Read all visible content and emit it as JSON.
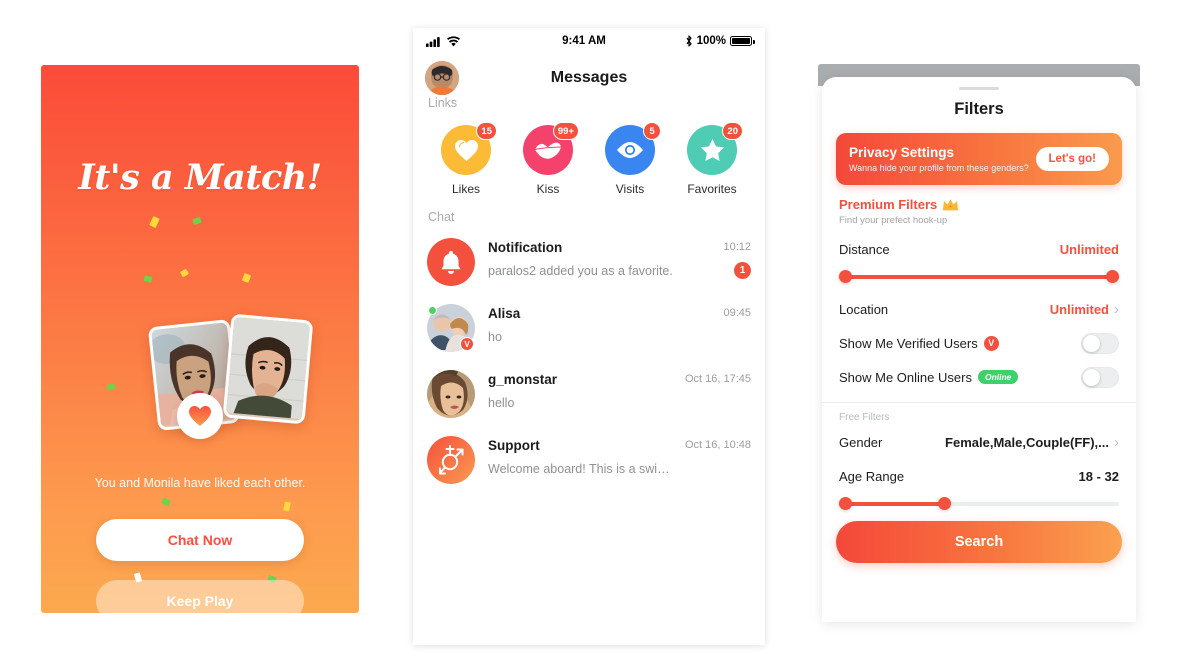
{
  "match_screen": {
    "title": "It's a Match!",
    "caption": "You and Monila have liked each other.",
    "primary_button": "Chat Now",
    "secondary_button": "Keep Play",
    "heart_icon": "heart-icon",
    "gradient_from": "#FB4B39",
    "gradient_to": "#FCA94F",
    "confetti_colors": [
      "#6CD34A",
      "#FFD83B",
      "#FFFFFF"
    ]
  },
  "messages_screen": {
    "status_bar": {
      "signal_icon": "cellular-signal-icon",
      "wifi_icon": "wifi-icon",
      "time": "9:41 AM",
      "bluetooth_icon": "bluetooth-icon",
      "battery_percent": "100%",
      "battery_icon": "battery-full-icon"
    },
    "header": {
      "title": "Messages",
      "avatar": "user-avatar",
      "links_label": "Links"
    },
    "quick_icons": [
      {
        "label": "Likes",
        "badge": "15",
        "color": "#FBBB36",
        "icon": "heart-icon"
      },
      {
        "label": "Kiss",
        "badge": "99+",
        "color": "#F5426C",
        "icon": "lips-icon"
      },
      {
        "label": "Visits",
        "badge": "5",
        "color": "#3A86F0",
        "icon": "eye-icon"
      },
      {
        "label": "Favorites",
        "badge": "20",
        "color": "#4ECDB4",
        "icon": "star-icon"
      }
    ],
    "chat_label": "Chat",
    "chats": [
      {
        "name": "Notification",
        "preview": "paralos2 added you as a favorite.",
        "time": "10:12",
        "unread": "1",
        "avatar_type": "bell-icon",
        "avatar_color": "#F4503E",
        "online": false,
        "verified": false
      },
      {
        "name": "Alisa",
        "preview": "ho",
        "time": "09:45",
        "unread": "",
        "avatar_type": "photo",
        "avatar_color": "#9ba7b4",
        "online": true,
        "verified": true
      },
      {
        "name": "g_monstar",
        "preview": "hello",
        "time": "Oct 16, 17:45",
        "unread": "",
        "avatar_type": "photo",
        "avatar_color": "#b8936a",
        "online": false,
        "verified": false
      },
      {
        "name": "Support",
        "preview": "Welcome aboard!  This is a swingers' ship rea…",
        "time": "Oct 16, 10:48",
        "unread": "",
        "avatar_type": "gender-icon",
        "avatar_color": "#F76B3C",
        "online": false,
        "verified": false
      }
    ]
  },
  "filters_screen": {
    "title": "Filters",
    "privacy": {
      "title": "Privacy Settings",
      "subtitle": "Wanna hide your profile from these genders?",
      "cta": "Let's go!"
    },
    "premium": {
      "title": "Premium Filters",
      "crown_icon": "crown-icon",
      "subtitle": "Find your prefect hook-up"
    },
    "distance": {
      "label": "Distance",
      "value": "Unlimited",
      "slider_start_pct": 0,
      "slider_end_pct": 100
    },
    "location": {
      "label": "Location",
      "value": "Unlimited",
      "chevron": "›"
    },
    "verified_users": {
      "label": "Show Me Verified Users",
      "badge": "V",
      "toggle_on": false
    },
    "online_users": {
      "label": "Show Me Online Users",
      "badge": "Online",
      "toggle_on": false
    },
    "free_label": "Free Filters",
    "gender": {
      "label": "Gender",
      "value": "Female,Male,Couple(FF),...",
      "chevron": "›"
    },
    "age_range": {
      "label": "Age Range",
      "value": "18 - 32",
      "slider_start_pct": 0,
      "slider_end_pct": 38
    },
    "search_button": "Search",
    "accent_color": "#F4503E"
  }
}
